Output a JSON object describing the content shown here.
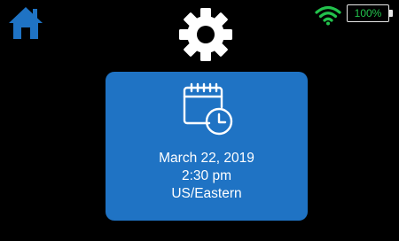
{
  "header": {
    "home_icon": "home-icon",
    "settings_icon": "gear-icon",
    "wifi_icon": "wifi-icon",
    "battery": {
      "level_percent": 100,
      "label": "100%",
      "text_color": "#22c24c"
    }
  },
  "card": {
    "icon": "calendar-clock-icon",
    "date": "March 22, 2019",
    "time": "2:30 pm",
    "timezone": "US/Eastern",
    "background_color": "#1f73c4"
  },
  "colors": {
    "home": "#1f73c4",
    "gear": "#ffffff",
    "wifi": "#22c24c",
    "background": "#000000"
  }
}
